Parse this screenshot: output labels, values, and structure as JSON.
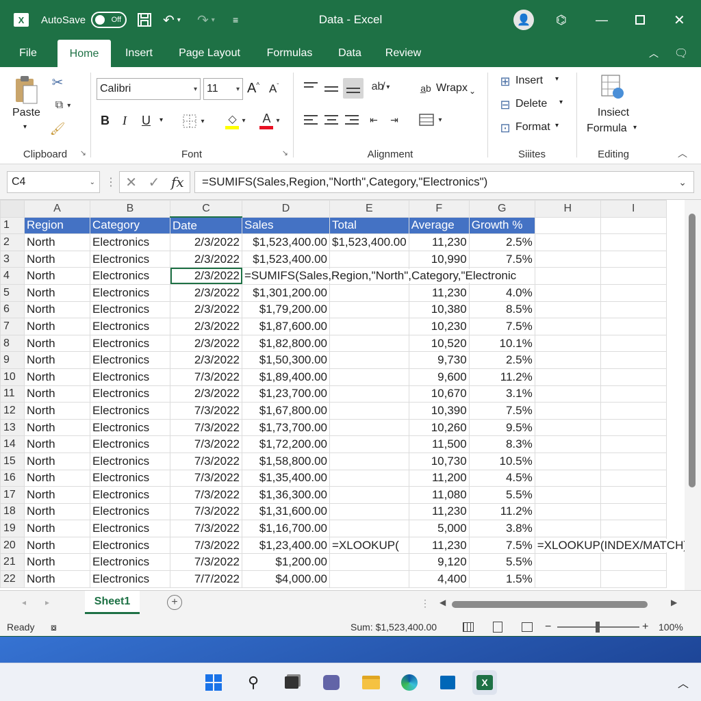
{
  "app": {
    "autosave_label": "AutoSave",
    "autosave_state": "Off",
    "title": "Data  -  Excel",
    "logo_letter": "X"
  },
  "tabs": [
    {
      "label": "File"
    },
    {
      "label": "Home"
    },
    {
      "label": "Insert"
    },
    {
      "label": "Page Layout"
    },
    {
      "label": "Formulas"
    },
    {
      "label": "Data"
    },
    {
      "label": "Review"
    }
  ],
  "ribbon": {
    "clipboard": {
      "label": "Clipboard",
      "paste": "Paste"
    },
    "font": {
      "label": "Font",
      "name": "Calibri",
      "size": "11",
      "grow": "A",
      "shrink": "A",
      "bold": "B",
      "italic": "I",
      "underline": "U",
      "font_color_letter": "A"
    },
    "alignment": {
      "label": "Alignment",
      "wrap": "Wrapx"
    },
    "cells": {
      "label": "Siiites",
      "insert": "Insert",
      "delete": "Delete",
      "format": "Format"
    },
    "editing": {
      "label": "Editing",
      "insert_formula_1": "Insiect",
      "insert_formula_2": "Formula"
    }
  },
  "formula_bar": {
    "name_box": "C4",
    "fx": "fx",
    "formula": "=SUMIFS(Sales,Region,\"North\",Category,\"Electronics\")"
  },
  "grid": {
    "columns": [
      "A",
      "B",
      "C",
      "D",
      "E",
      "F",
      "G",
      "H",
      "I"
    ],
    "headers": [
      "Region",
      "Category",
      "Date",
      "Sales",
      "Total",
      "Average",
      "Growth %"
    ],
    "rows": [
      {
        "n": "1"
      },
      {
        "n": "2",
        "a": "North",
        "b": "Electronics",
        "c": "2/3/2022",
        "d": "$1,523,400.00",
        "e": "$1,523,400.00",
        "f": "11,230",
        "g": "2.5%"
      },
      {
        "n": "3",
        "a": "North",
        "b": "Electronics",
        "c": "2/3/2022",
        "d": "$1,523,400.00",
        "e": "",
        "f": "10,990",
        "g": "7.5%"
      },
      {
        "n": "4",
        "a": "North",
        "b": "Electronics",
        "c": "2/3/2022",
        "d": "=SUMIFS(Sales,Region,\"North\",Category,\"Electronic",
        "e": "",
        "f": "",
        "g": ""
      },
      {
        "n": "5",
        "a": "North",
        "b": "Electronics",
        "c": "2/3/2022",
        "d": "$1,301,200.00",
        "e": "",
        "f": "11,230",
        "g": "4.0%"
      },
      {
        "n": "6",
        "a": "North",
        "b": "Electronics",
        "c": "2/3/2022",
        "d": "$1,79,200.00",
        "e": "",
        "f": "10,380",
        "g": "8.5%"
      },
      {
        "n": "7",
        "a": "North",
        "b": "Electronics",
        "c": "2/3/2022",
        "d": "$1,87,600.00",
        "e": "",
        "f": "10,230",
        "g": "7.5%"
      },
      {
        "n": "8",
        "a": "North",
        "b": "Electronics",
        "c": "2/3/2022",
        "d": "$1,82,800.00",
        "e": "",
        "f": "10,520",
        "g": "10.1%"
      },
      {
        "n": "9",
        "a": "North",
        "b": "Electronics",
        "c": "2/3/2022",
        "d": "$1,50,300.00",
        "e": "",
        "f": "9,730",
        "g": "2.5%"
      },
      {
        "n": "10",
        "a": "North",
        "b": "Electronics",
        "c": "7/3/2022",
        "d": "$1,89,400.00",
        "e": "",
        "f": "9,600",
        "g": "11.2%"
      },
      {
        "n": "11",
        "a": "North",
        "b": "Electronics",
        "c": "2/3/2022",
        "d": "$1,23,700.00",
        "e": "",
        "f": "10,670",
        "g": "3.1%"
      },
      {
        "n": "12",
        "a": "North",
        "b": "Electronics",
        "c": "7/3/2022",
        "d": "$1,67,800.00",
        "e": "",
        "f": "10,390",
        "g": "7.5%"
      },
      {
        "n": "13",
        "a": "North",
        "b": "Electronics",
        "c": "7/3/2022",
        "d": "$1,73,700.00",
        "e": "",
        "f": "10,260",
        "g": "9.5%"
      },
      {
        "n": "14",
        "a": "North",
        "b": "Electronics",
        "c": "7/3/2022",
        "d": "$1,72,200.00",
        "e": "",
        "f": "11,500",
        "g": "8.3%"
      },
      {
        "n": "15",
        "a": "North",
        "b": "Electronics",
        "c": "7/3/2022",
        "d": "$1,58,800.00",
        "e": "",
        "f": "10,730",
        "g": "10.5%"
      },
      {
        "n": "16",
        "a": "North",
        "b": "Electronics",
        "c": "7/3/2022",
        "d": "$1,35,400.00",
        "e": "",
        "f": "11,200",
        "g": "4.5%"
      },
      {
        "n": "17",
        "a": "North",
        "b": "Electronics",
        "c": "7/3/2022",
        "d": "$1,36,300.00",
        "e": "",
        "f": "11,080",
        "g": "5.5%"
      },
      {
        "n": "18",
        "a": "North",
        "b": "Electronics",
        "c": "7/3/2022",
        "d": "$1,31,600.00",
        "e": "",
        "f": "11,230",
        "g": "11.2%"
      },
      {
        "n": "19",
        "a": "North",
        "b": "Electronics",
        "c": "7/3/2022",
        "d": "$1,16,700.00",
        "e": "",
        "f": "5,000",
        "g": "3.8%"
      },
      {
        "n": "20",
        "a": "North",
        "b": "Electronics",
        "c": "7/3/2022",
        "d": "$1,23,400.00",
        "e": "=XLOOKUP(",
        "f": "11,230",
        "g": "7.5%",
        "h": "=XLOOKUP(INDEX/MATCH)"
      },
      {
        "n": "21",
        "a": "North",
        "b": "Electronics",
        "c": "7/3/2022",
        "d": "$1,200.00",
        "e": "",
        "f": "9,120",
        "g": "5.5%"
      },
      {
        "n": "22",
        "a": "North",
        "b": "Electronics",
        "c": "7/7/2022",
        "d": "$4,000.00",
        "e": "",
        "f": "4,400",
        "g": "1.5%"
      }
    ]
  },
  "sheets": [
    {
      "label": "Sheet1"
    }
  ],
  "status": {
    "ready": "Ready",
    "sum": "Sum: $1,523,400.00",
    "zoom": "100%"
  },
  "colors": {
    "excel_green": "#1e7145",
    "header_fill": "#4472c4"
  }
}
